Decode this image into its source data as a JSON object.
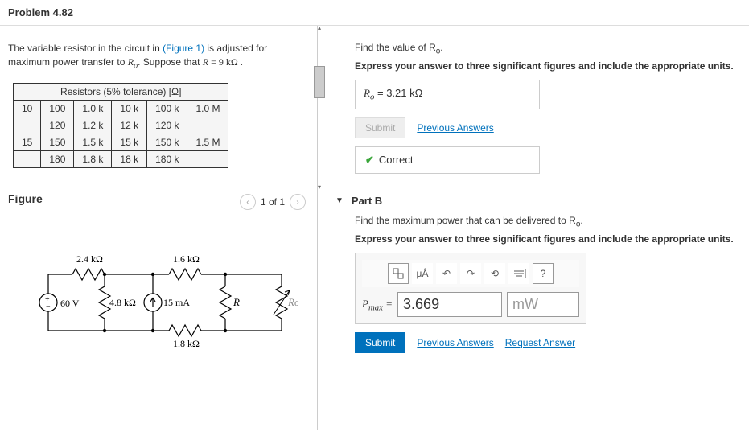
{
  "header": {
    "title": "Problem 4.82"
  },
  "intro": {
    "pre": "The variable resistor in the circuit in ",
    "figref": "(Figure 1)",
    "mid": " is adjusted for maximum power transfer to ",
    "rvar": "R",
    "rsub": "o",
    "post": ". Suppose that ",
    "eq_lhs": "R",
    "eq": " = 9  kΩ ."
  },
  "table": {
    "head": "Resistors (5% tolerance) [Ω]",
    "rows": [
      [
        "10",
        "100",
        "1.0 k",
        "10 k",
        "100 k",
        "1.0 M"
      ],
      [
        "",
        "120",
        "1.2 k",
        "12 k",
        "120 k",
        ""
      ],
      [
        "15",
        "150",
        "1.5 k",
        "15 k",
        "150 k",
        "1.5 M"
      ],
      [
        "",
        "180",
        "1.8 k",
        "18 k",
        "180 k",
        ""
      ]
    ]
  },
  "figure": {
    "label": "Figure",
    "count": "1 of 1",
    "r1": "2.4 kΩ",
    "r2": "1.6 kΩ",
    "r3": "4.8 kΩ",
    "r4": "1.8 kΩ",
    "v": "60 V",
    "i": "15 mA",
    "rvar": "R",
    "rout": "Ro"
  },
  "partA": {
    "find": "Find the value of ",
    "rvar": "R",
    "rsub": "o",
    "dot": ".",
    "instr": "Express your answer to three significant figures and include the appropriate units.",
    "ans_lhs": "R",
    "ans_sub": "o",
    "ans_eq": " =   3.21 kΩ",
    "submit": "Submit",
    "prev": "Previous Answers",
    "correct": "Correct"
  },
  "partB": {
    "title": "Part B",
    "find": "Find the maximum power that can be delivered to ",
    "rvar": "R",
    "rsub": "o",
    "dot": ".",
    "instr": "Express your answer to three significant figures and include the appropriate units.",
    "unitbtn": "μÅ",
    "help": "?",
    "lbl_pre": "P",
    "lbl_sub": "max",
    "lbl_eq": " = ",
    "value": "3.669",
    "unit_ph": "mW",
    "submit": "Submit",
    "prev": "Previous Answers",
    "req": "Request Answer"
  }
}
